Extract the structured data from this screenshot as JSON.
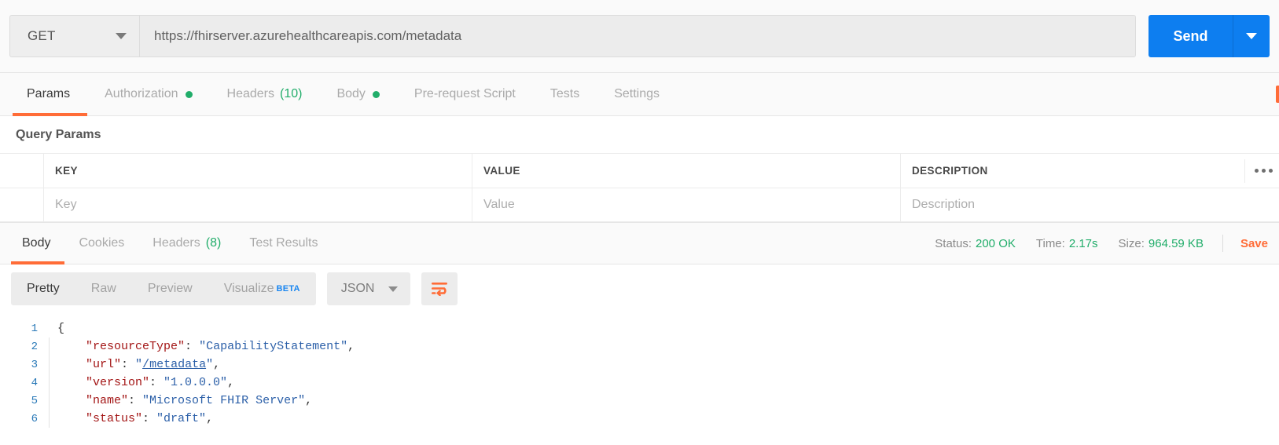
{
  "request": {
    "method": "GET",
    "url": "https://fhirserver.azurehealthcareapis.com/metadata",
    "send_label": "Send",
    "tabs": [
      {
        "label": "Params",
        "active": true,
        "dot": false,
        "count": ""
      },
      {
        "label": "Authorization",
        "active": false,
        "dot": true,
        "count": ""
      },
      {
        "label": "Headers",
        "active": false,
        "dot": false,
        "count": "(10)"
      },
      {
        "label": "Body",
        "active": false,
        "dot": true,
        "count": ""
      },
      {
        "label": "Pre-request Script",
        "active": false,
        "dot": false,
        "count": ""
      },
      {
        "label": "Tests",
        "active": false,
        "dot": false,
        "count": ""
      },
      {
        "label": "Settings",
        "active": false,
        "dot": false,
        "count": ""
      }
    ]
  },
  "query_params": {
    "section_title": "Query Params",
    "columns": [
      "KEY",
      "VALUE",
      "DESCRIPTION"
    ],
    "row_placeholders": [
      "Key",
      "Value",
      "Description"
    ]
  },
  "response": {
    "tabs": [
      {
        "label": "Body",
        "active": true,
        "count": ""
      },
      {
        "label": "Cookies",
        "active": false,
        "count": ""
      },
      {
        "label": "Headers",
        "active": false,
        "count": "(8)"
      },
      {
        "label": "Test Results",
        "active": false,
        "count": ""
      }
    ],
    "meta": {
      "status_label": "Status:",
      "status_value": "200 OK",
      "time_label": "Time:",
      "time_value": "2.17s",
      "size_label": "Size:",
      "size_value": "964.59 KB"
    },
    "save_label": "Save",
    "format_tabs": [
      {
        "label": "Pretty",
        "active": true,
        "badge": ""
      },
      {
        "label": "Raw",
        "active": false,
        "badge": ""
      },
      {
        "label": "Preview",
        "active": false,
        "badge": ""
      },
      {
        "label": "Visualize",
        "active": false,
        "badge": "BETA"
      }
    ],
    "language": "JSON",
    "code_lines": [
      {
        "n": "1",
        "segments": [
          {
            "t": "{",
            "c": "p"
          }
        ]
      },
      {
        "n": "2",
        "segments": [
          {
            "t": "    ",
            "c": "p"
          },
          {
            "t": "\"resourceType\"",
            "c": "k"
          },
          {
            "t": ": ",
            "c": "p"
          },
          {
            "t": "\"CapabilityStatement\"",
            "c": "s"
          },
          {
            "t": ",",
            "c": "p"
          }
        ]
      },
      {
        "n": "3",
        "segments": [
          {
            "t": "    ",
            "c": "p"
          },
          {
            "t": "\"url\"",
            "c": "k"
          },
          {
            "t": ": ",
            "c": "p"
          },
          {
            "t": "\"",
            "c": "s"
          },
          {
            "t": "/metadata",
            "c": "lnk"
          },
          {
            "t": "\"",
            "c": "s"
          },
          {
            "t": ",",
            "c": "p"
          }
        ]
      },
      {
        "n": "4",
        "segments": [
          {
            "t": "    ",
            "c": "p"
          },
          {
            "t": "\"version\"",
            "c": "k"
          },
          {
            "t": ": ",
            "c": "p"
          },
          {
            "t": "\"1.0.0.0\"",
            "c": "s"
          },
          {
            "t": ",",
            "c": "p"
          }
        ]
      },
      {
        "n": "5",
        "segments": [
          {
            "t": "    ",
            "c": "p"
          },
          {
            "t": "\"name\"",
            "c": "k"
          },
          {
            "t": ": ",
            "c": "p"
          },
          {
            "t": "\"Microsoft FHIR Server\"",
            "c": "s"
          },
          {
            "t": ",",
            "c": "p"
          }
        ]
      },
      {
        "n": "6",
        "segments": [
          {
            "t": "    ",
            "c": "p"
          },
          {
            "t": "\"status\"",
            "c": "k"
          },
          {
            "t": ": ",
            "c": "p"
          },
          {
            "t": "\"draft\"",
            "c": "s"
          },
          {
            "t": ",",
            "c": "p"
          }
        ]
      }
    ]
  },
  "colors": {
    "accent_orange": "#ff6c37",
    "send_blue": "#0d7ef0",
    "success_green": "#21ad6a",
    "beta_blue": "#1a86f0",
    "json_key": "#a31515",
    "json_string": "#2b5fa8"
  }
}
